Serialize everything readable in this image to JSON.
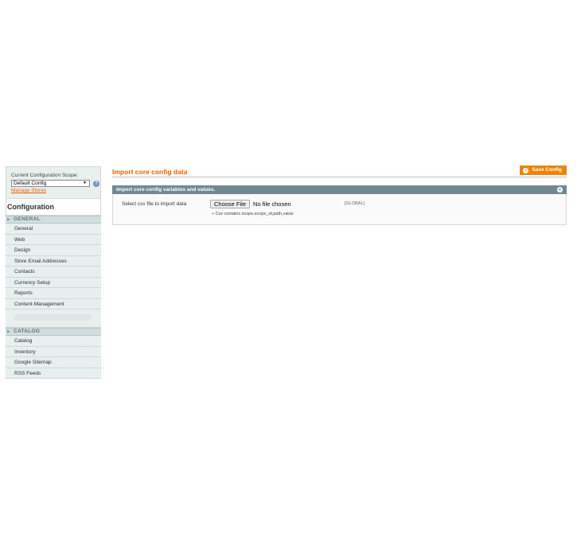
{
  "sidebar": {
    "scope_label": "Current Configuration Scope:",
    "scope_value": "Default Config",
    "manage_link": "Manage Stores",
    "title": "Configuration",
    "sections": [
      {
        "label": "GENERAL",
        "items": [
          "General",
          "Web",
          "Design",
          "Store Email Addresses",
          "Contacts",
          "Currency Setup",
          "Reports",
          "Content Management"
        ]
      },
      {
        "label": "CATALOG",
        "items": [
          "Catalog",
          "Inventory",
          "Google Sitemap",
          "RSS Feeds"
        ]
      }
    ]
  },
  "main": {
    "title": "Import core config data",
    "save_label": "Save Config",
    "fieldset_title": "Import core config variables and values.",
    "field_label": "Select csv file to import data",
    "choose_button": "Choose File",
    "file_status": "No file chosen",
    "note": "Csv contains scope,scope_id,path,value",
    "scope_tag": "[GLOBAL]"
  },
  "colors": {
    "accent": "#eb5e00",
    "button": "#f18200",
    "fieldset_header": "#6f8992",
    "sidebar_bg": "#e7efef"
  },
  "icons": [
    "chevron-down-icon",
    "help-icon",
    "check-icon",
    "collapse-icon",
    "triangle-right-icon"
  ]
}
